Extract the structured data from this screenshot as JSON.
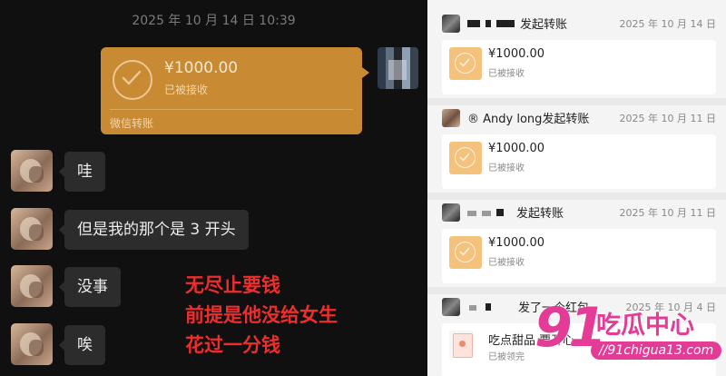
{
  "chat": {
    "timestamp": "2025 年 10 月 14 日  10:39",
    "transfer": {
      "amount": "¥1000.00",
      "status": "已被接收",
      "label": "微信转账"
    },
    "messages": [
      {
        "text": "哇"
      },
      {
        "text": "但是我的那个是 3 开头"
      },
      {
        "text": "没事"
      },
      {
        "text": "唉"
      }
    ],
    "overlay": [
      "无尽止要钱",
      "前提是他没给女生",
      "花过一分钱"
    ]
  },
  "history": {
    "records": [
      {
        "title": "发起转账",
        "date": "2025 年 10 月 14 日",
        "amount": "¥1000.00",
        "status": "已被接收"
      },
      {
        "title": "® Andy  long发起转账",
        "date": "2025 年 10 月 11 日",
        "amount": "¥1000.00",
        "status": "已被接收"
      },
      {
        "title": "发起转账",
        "date": "2025 年 10 月 11 日",
        "amount": "¥1000.00",
        "status": "已被接收"
      },
      {
        "title": "发了一个红包",
        "date": "2025 年 10 月 4 日",
        "amount": "吃点甜品  要开心",
        "status": "已被领完"
      }
    ]
  },
  "watermark": {
    "number": "91",
    "text": "吃瓜中心",
    "url": "//91chigua13.com"
  },
  "colors": {
    "transfer_orange": "#c98a34",
    "chat_bg": "#101010",
    "overlay_red": "#ee2d2d",
    "watermark_pink": "#e43b96"
  }
}
